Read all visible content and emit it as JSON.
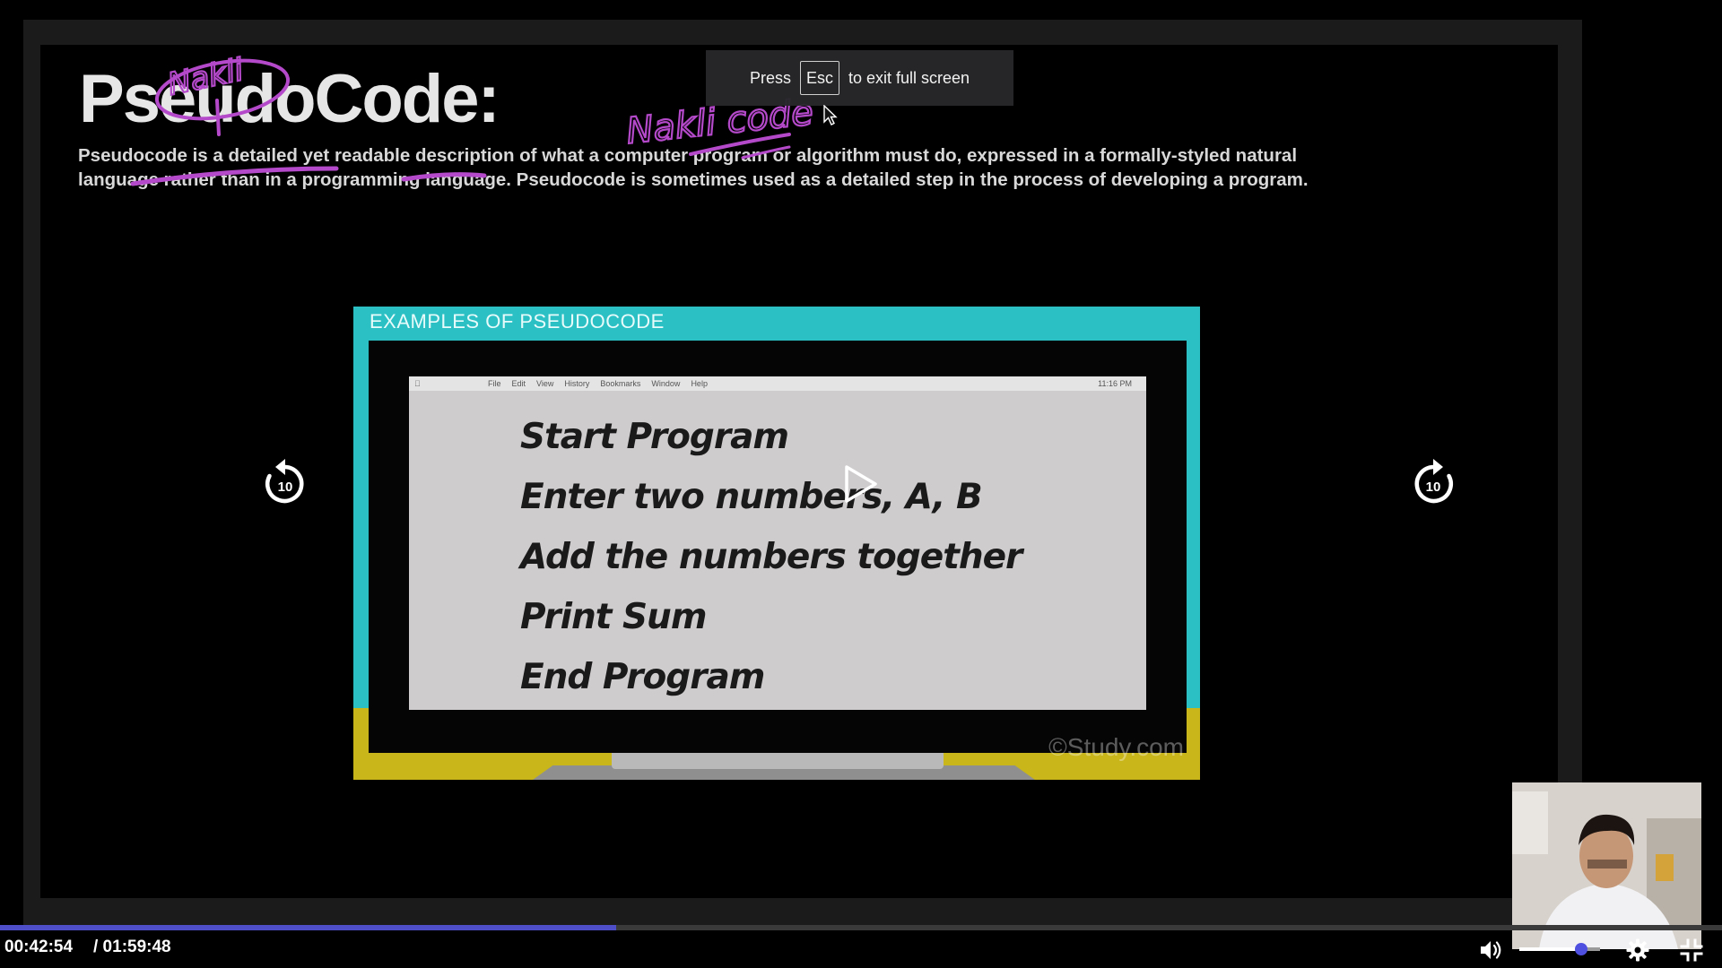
{
  "slide": {
    "title": "PseudoCode:",
    "description_line1": "Pseudocode  is a detailed yet readable description of what a computer program or algorithm must do, expressed in a formally-styled natural",
    "description_line2": "language rather than in a programming language. Pseudocode is sometimes used as a detailed step in the process of developing a program.",
    "annotations": {
      "circled": "Nakli",
      "note": "Nakli code"
    },
    "example": {
      "header": "EXAMPLES OF PSEUDOCODE",
      "watermark": "©Study.com",
      "menubar": {
        "apple": "",
        "items": [
          "File",
          "Edit",
          "View",
          "History",
          "Bookmarks",
          "Window",
          "Help"
        ],
        "clock": "11:16 PM"
      },
      "lines": [
        "Start Program",
        "Enter two numbers, A, B",
        "Add the numbers together",
        "Print Sum",
        "End Program"
      ]
    }
  },
  "toast": {
    "prefix": "Press",
    "key": "Esc",
    "suffix": "to exit full screen"
  },
  "player": {
    "rewind_label": "10",
    "forward_label": "10",
    "current_time": "00:42:54",
    "duration": "/ 01:59:48",
    "progress": 0.358,
    "volume": 0.77,
    "icons": {
      "rewind": "rewind-10-icon",
      "forward": "forward-10-icon",
      "play": "play-icon",
      "volume": "volume-icon",
      "settings": "gear-icon",
      "exit_fullscreen": "exit-fullscreen-icon"
    },
    "colors": {
      "progress": "#4e4ec8",
      "annotation": "#b449c9",
      "example_teal": "#2bc0c4",
      "example_yellow": "#c9b61a"
    }
  }
}
